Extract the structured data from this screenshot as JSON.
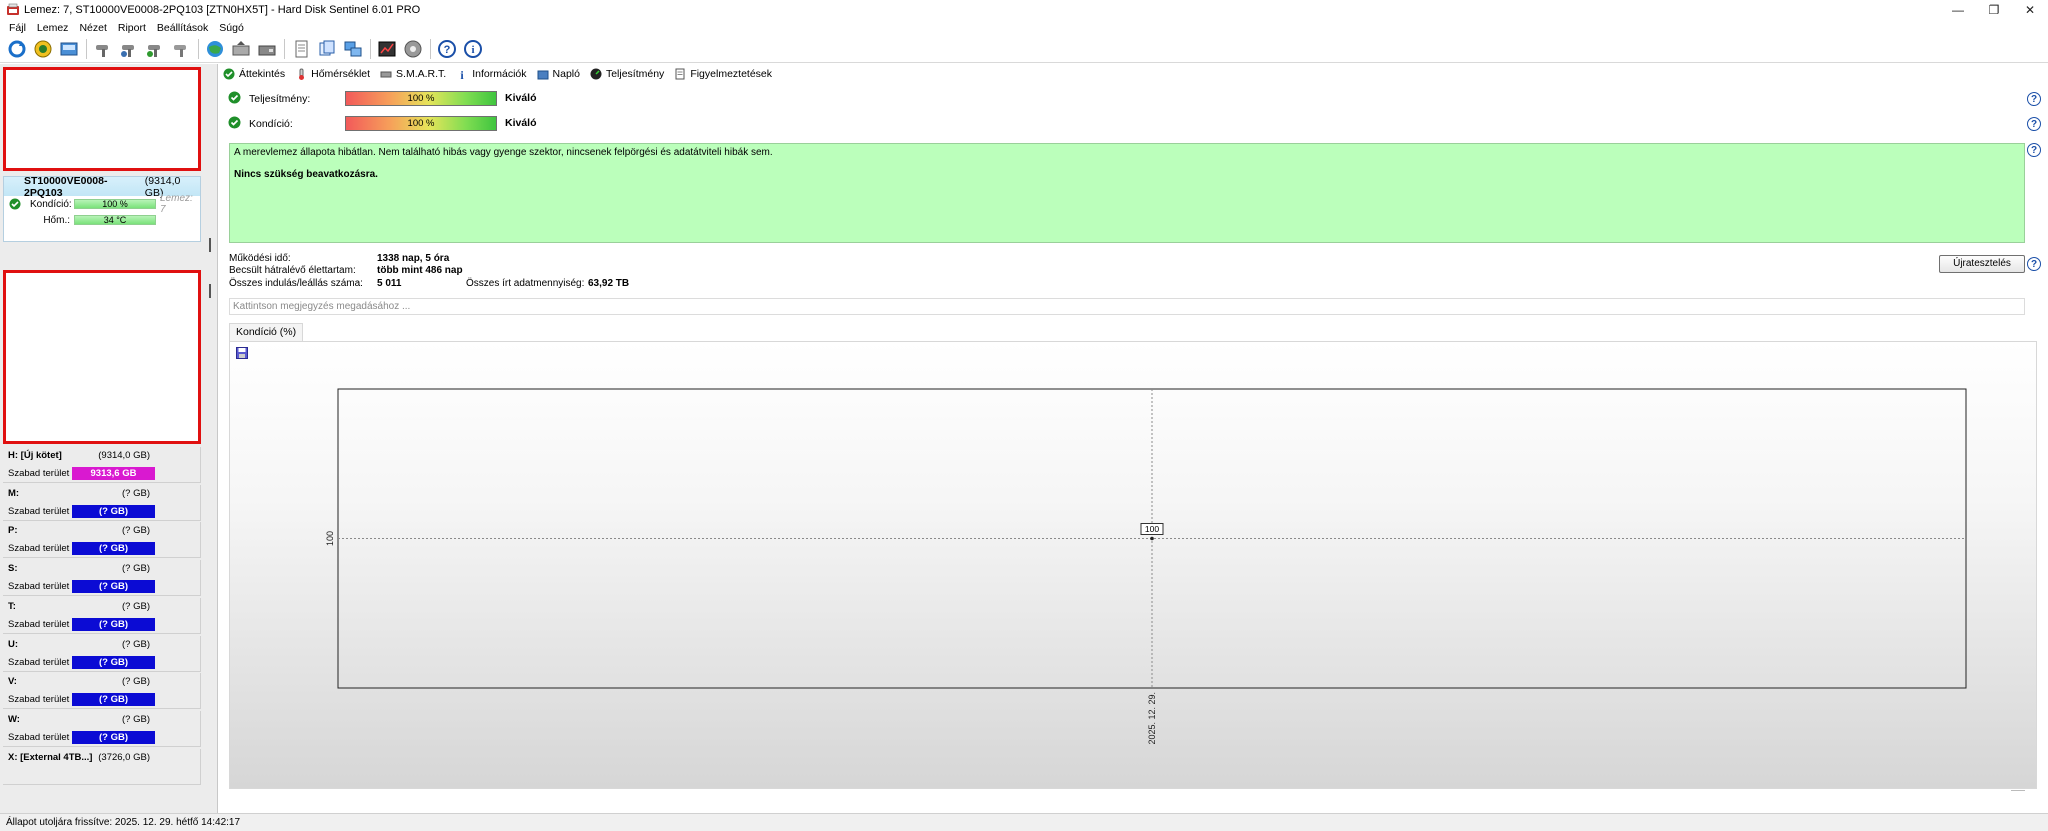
{
  "window": {
    "title": "Lemez: 7, ST10000VE0008-2PQ103 [ZTN0HX5T]  -  Hard Disk Sentinel 6.01 PRO",
    "controls": [
      "—",
      "❐",
      "✕"
    ]
  },
  "menu": [
    "Fájl",
    "Lemez",
    "Nézet",
    "Riport",
    "Beállítások",
    "Súgó"
  ],
  "toolbar": {
    "icons": [
      "refresh-icon",
      "alert-icon",
      "disk-info-icon",
      "separator",
      "wrench-icon",
      "wrench-gear-icon",
      "wrench-check-icon",
      "wrench-alt-icon",
      "separator",
      "globe-icon",
      "hdd-arrow-icon",
      "hdd-icon",
      "separator",
      "report-icon",
      "copy-icon",
      "network-icon",
      "separator",
      "chart-icon",
      "sound-icon",
      "separator",
      "help-icon",
      "info-icon"
    ]
  },
  "disk_card": {
    "model": "ST10000VE0008-2PQ103",
    "size": "(9314,0 GB)",
    "condition_label": "Kondíció:",
    "condition_value": "100 %",
    "disk_number": "Lemez: 7",
    "temp_label": "Hőm.:",
    "temp_value": "34 °C"
  },
  "volumes": [
    {
      "name": "H: [Új kötet]",
      "size": "(9314,0 GB)",
      "free_label": "Szabad terület",
      "free_value": "9313,6 GB",
      "color": "#d919d0"
    },
    {
      "name": "M:",
      "size": "(? GB)",
      "free_label": "Szabad terület",
      "free_value": "(? GB)",
      "color": "#0b0bd4"
    },
    {
      "name": "P:",
      "size": "(? GB)",
      "free_label": "Szabad terület",
      "free_value": "(? GB)",
      "color": "#0b0bd4"
    },
    {
      "name": "S:",
      "size": "(? GB)",
      "free_label": "Szabad terület",
      "free_value": "(? GB)",
      "color": "#0b0bd4"
    },
    {
      "name": "T:",
      "size": "(? GB)",
      "free_label": "Szabad terület",
      "free_value": "(? GB)",
      "color": "#0b0bd4"
    },
    {
      "name": "U:",
      "size": "(? GB)",
      "free_label": "Szabad terület",
      "free_value": "(? GB)",
      "color": "#0b0bd4"
    },
    {
      "name": "V:",
      "size": "(? GB)",
      "free_label": "Szabad terület",
      "free_value": "(? GB)",
      "color": "#0b0bd4"
    },
    {
      "name": "W:",
      "size": "(? GB)",
      "free_label": "Szabad terület",
      "free_value": "(? GB)",
      "color": "#0b0bd4"
    },
    {
      "name": "X: [External 4TB...]",
      "size": "(3726,0 GB)",
      "free_label": "",
      "free_value": "",
      "color": "#0b0bd4"
    }
  ],
  "tabs": [
    "Áttekintés",
    "Hőmérséklet",
    "S.M.A.R.T.",
    "Információk",
    "Napló",
    "Teljesítmény",
    "Figyelmeztetések"
  ],
  "performance": {
    "label": "Teljesítmény:",
    "value": "100 %",
    "status": "Kiváló",
    "fill": 1.0
  },
  "condition": {
    "label": "Kondíció:",
    "value": "100 %",
    "status": "Kiváló",
    "fill": 1.0
  },
  "message": {
    "line1": "A merevlemez állapota hibátlan. Nem található hibás vagy gyenge szektor, nincsenek felpörgési és adatátviteli hibák sem.",
    "line2": "Nincs szükség beavatkozásra."
  },
  "stats": {
    "uptime_label": "Működési idő:",
    "uptime_value": "1338 nap, 5 óra",
    "remaining_label": "Becsült hátralévő élettartam:",
    "remaining_value": "több mint 486 nap",
    "starts_label": "Összes indulás/leállás száma:",
    "starts_value": "5 011",
    "written_label": "Összes írt adatmennyiség:",
    "written_value": "63,92 TB"
  },
  "reset_button": "Újratesztelés",
  "note_placeholder": "Kattintson megjegyzés megadásához ...",
  "chart_tab": "Kondíció  (%)",
  "chart_data": {
    "type": "line",
    "title": "",
    "x": [
      "2025. 12. 29."
    ],
    "series": [
      {
        "name": "",
        "values": [
          100
        ]
      }
    ],
    "data_labels": [
      "100"
    ],
    "y_tick_labels": [
      "100"
    ],
    "grid": true
  },
  "statusbar": "Állapot utoljára frissítve: 2025. 12. 29. hétfő 14:42:17",
  "colors": {
    "accent": "#1a4fa8",
    "ok_green": "#bbffbb",
    "red_box": "#e01010"
  }
}
